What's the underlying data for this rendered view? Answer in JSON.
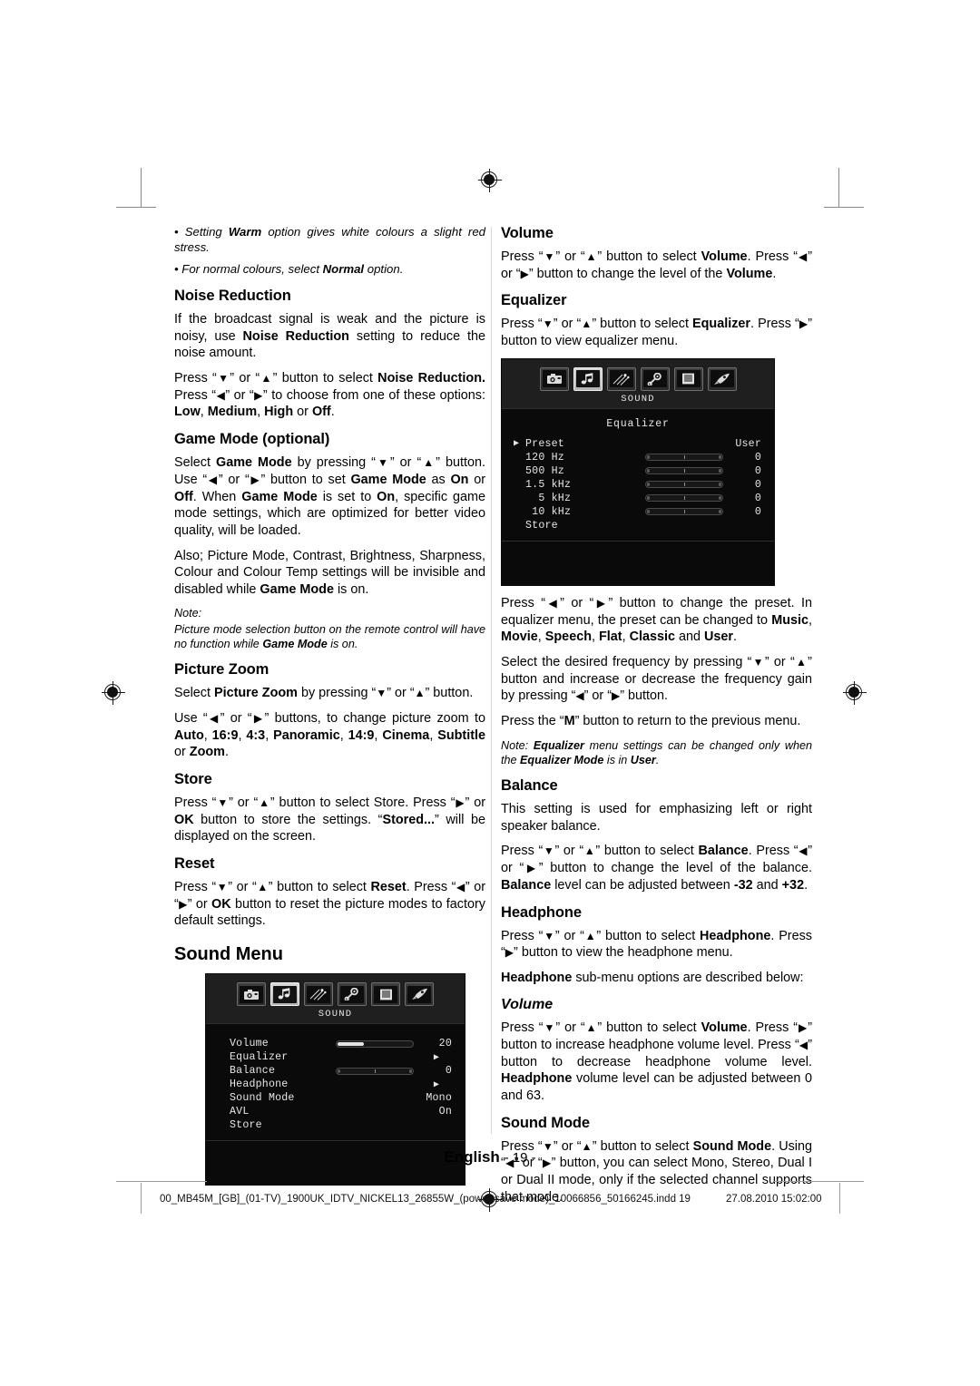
{
  "document": {
    "footer": {
      "language": "English",
      "page_number": "- 19 -",
      "imprint_code": "00_MB45M_[GB]_(01-TV)_1900UK_IDTV_NICKEL13_26855W_(power save mode)_10066856_50166245.indd   19",
      "imprint_date": "27.08.2010   15:02:00"
    }
  },
  "left_column": {
    "bullets": [
      "• Setting Warm option gives white colours a slight red stress.",
      "• For normal colours, select Normal option."
    ],
    "noise_reduction": {
      "heading": "Noise Reduction",
      "p1": "If the broadcast signal is weak and the picture is noisy, use Noise Reduction setting to reduce the noise amount.",
      "p2": "Press “▼” or “▲” button to select Noise Reduction. Press “◀” or “▶” to choose from one of these options: Low, Medium, High or Off."
    },
    "game_mode": {
      "heading": "Game Mode (optional)",
      "p1": "Select Game Mode by pressing “▼” or “▲” button. Use “◀” or “▶” button to set Game Mode as On or Off. When Game Mode is set to On, specific game mode settings, which are optimized for better video quality, will be loaded.",
      "p2": "Also; Picture Mode, Contrast, Brightness, Sharpness, Colour and Colour Temp settings will be invisible and disabled while Game Mode is on.",
      "note_label": "Note:",
      "note_text": "Picture mode selection button on the remote control will have no function while Game Mode is on."
    },
    "picture_zoom": {
      "heading": "Picture Zoom",
      "p1": "Select Picture Zoom by pressing “▼” or “▲” button.",
      "p2": "Use “◀” or “▶” buttons, to change picture zoom to Auto, 16:9, 4:3, Panoramic, 14:9, Cinema, Subtitle or Zoom."
    },
    "store": {
      "heading": "Store",
      "p1": "Press “▼” or “▲” button to select Store. Press “▶” or OK button to store the settings. “Stored...” will be displayed on the screen."
    },
    "reset": {
      "heading": "Reset",
      "p1": "Press “▼” or “▲” button to select Reset. Press “◀” or “▶” or OK button to reset the picture modes to factory default settings."
    },
    "sound_menu_heading": "Sound Menu"
  },
  "right_column": {
    "volume": {
      "heading": "Volume",
      "p1": "Press “▼” or “▲” button to select Volume. Press “◀” or “▶” button to change the level of the Volume."
    },
    "equalizer": {
      "heading": "Equalizer",
      "p1": "Press “▼” or “▲” button to select Equalizer. Press “▶” button to view equalizer menu.",
      "p2": "Press “◀” or “▶” button to change the preset. In equalizer menu, the preset can be changed to Music, Movie, Speech, Flat, Classic and User.",
      "p3": "Select the desired frequency by pressing “▼” or “▲” button and increase or decrease the frequency gain by pressing “◀” or “▶” button.",
      "p4": "Press the “M” button to return to the previous menu.",
      "note": "Note: Equalizer menu settings can be changed only when the Equalizer Mode is in User."
    },
    "balance": {
      "heading": "Balance",
      "p1": "This setting is used for emphasizing left or right speaker balance.",
      "p2": "Press “▼” or “▲” button to select Balance. Press “◀” or “▶” button to change the level of the balance. Balance level can be adjusted between -32 and +32."
    },
    "headphone": {
      "heading": "Headphone",
      "p1": "Press “▼” or “▲” button to select Headphone. Press “▶” button to view the headphone menu.",
      "p2": "Headphone sub-menu options are described below:"
    },
    "headphone_volume": {
      "heading": "Volume",
      "p1": "Press “▼” or “▲” button to select Volume. Press “▶” button to increase headphone volume level. Press “◀” button to decrease headphone volume level. Headphone volume level can be adjusted between 0 and 63."
    },
    "sound_mode": {
      "heading": "Sound Mode",
      "p1": "Press “▼” or “▲” button to select Sound Mode. Using “◀” or “▶” button, you can select Mono, Stereo, Dual I or Dual II mode, only if the selected channel supports that mode."
    }
  },
  "osd_sound_menu": {
    "tab_label": "SOUND",
    "icons": [
      "picture-camera-icon",
      "sound-note-icon",
      "feature-comet-icon",
      "install-key-icon",
      "list-icon",
      "source-rocket-icon"
    ],
    "selected_icon_index": 1,
    "rows": [
      {
        "label": "Volume",
        "type": "slider",
        "value": "20",
        "fill_percent": 35
      },
      {
        "label": "Equalizer",
        "type": "caret",
        "value": "▶"
      },
      {
        "label": "Balance",
        "type": "center",
        "value": "0"
      },
      {
        "label": "Headphone",
        "type": "caret",
        "value": "▶"
      },
      {
        "label": "Sound Mode",
        "type": "text",
        "value": "Mono"
      },
      {
        "label": "AVL",
        "type": "text",
        "value": "On"
      },
      {
        "label": "Store",
        "type": "none",
        "value": ""
      }
    ]
  },
  "osd_equalizer": {
    "tab_label": "SOUND",
    "title": "Equalizer",
    "icons": [
      "picture-camera-icon",
      "sound-note-icon",
      "feature-comet-icon",
      "install-key-icon",
      "list-icon",
      "source-rocket-icon"
    ],
    "selected_icon_index": 1,
    "rows": [
      {
        "label": "Preset",
        "type": "text",
        "value": "User",
        "cursor": true
      },
      {
        "label": "120 Hz",
        "type": "center",
        "value": "0"
      },
      {
        "label": "500 Hz",
        "type": "center",
        "value": "0"
      },
      {
        "label": "1.5 kHz",
        "type": "center",
        "value": "0"
      },
      {
        "label": "  5 kHz",
        "type": "center",
        "value": "0"
      },
      {
        "label": " 10 kHz",
        "type": "center",
        "value": "0"
      },
      {
        "label": "Store",
        "type": "none",
        "value": ""
      }
    ]
  }
}
